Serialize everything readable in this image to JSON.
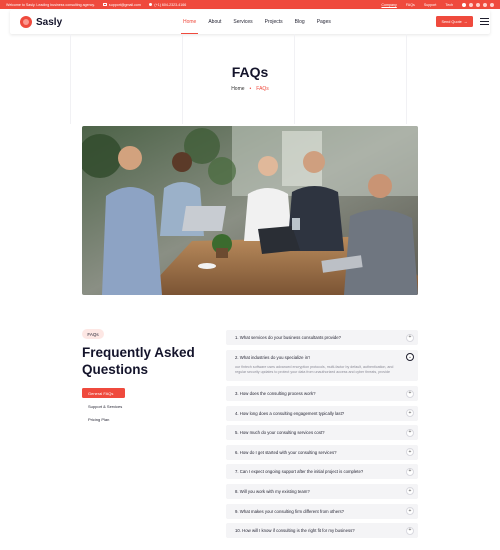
{
  "topbar": {
    "welcome": "Welcome to Sasly. Leading business consulting agency.",
    "email": "support@gmail.com",
    "phone": "(+1) 604-2323-4166",
    "links": [
      "Company",
      "FAQs",
      "Support"
    ],
    "language": "Tech",
    "colors": {
      "bar": "#ef4a3d"
    }
  },
  "header": {
    "brand": "Sasly",
    "nav": [
      "Home",
      "About",
      "Services",
      "Projects",
      "Blog",
      "Pages"
    ],
    "active_nav": "Home",
    "cta_label": "Send Quote"
  },
  "hero": {
    "title": "FAQs",
    "breadcrumb_home": "Home",
    "breadcrumb_sep": "•",
    "breadcrumb_current": "FAQs"
  },
  "faq_section": {
    "badge": "FAQs",
    "heading": "Frequently Asked Questions",
    "tabs": [
      "General FAQs",
      "Support & Services",
      "Pricing Plan"
    ],
    "active_tab": "General FAQs",
    "items": [
      {
        "q": "1.  What services do your business consultants provide?",
        "toggle": "+",
        "open": false
      },
      {
        "q": "2.  What industries do you specialize in?",
        "toggle": "⌄",
        "open": true,
        "answer": "our fintech software uses advanced encryption protocols, multi-factor by default, authentication, and regular security updates to protect your data from unauthorized access and cyber threats, provide"
      },
      {
        "q": "3.  How does the consulting process work?",
        "toggle": "+",
        "open": false
      },
      {
        "q": "4.  How long does a consulting engagement typically last?",
        "toggle": "+",
        "open": false
      },
      {
        "q": "5.  How much do your consulting services cost?",
        "toggle": "+",
        "open": false
      },
      {
        "q": "6.  How do I get started with your consulting services?",
        "toggle": "+",
        "open": false
      },
      {
        "q": "7.  Can I expect ongoing support after the initial project is complete?",
        "toggle": "+",
        "open": false
      },
      {
        "q": "8.  Will you work with my existing team?",
        "toggle": "+",
        "open": false
      },
      {
        "q": "9.  What makes your consulting firm different from others?",
        "toggle": "+",
        "open": false
      },
      {
        "q": "10.  How will I know if consulting is the right fit for my business?",
        "toggle": "+",
        "open": false
      }
    ]
  },
  "colors": {
    "accent": "#ef4a3d",
    "accent_soft": "#fde7e4",
    "heading": "#14142b",
    "panel": "#f4f4f6"
  }
}
